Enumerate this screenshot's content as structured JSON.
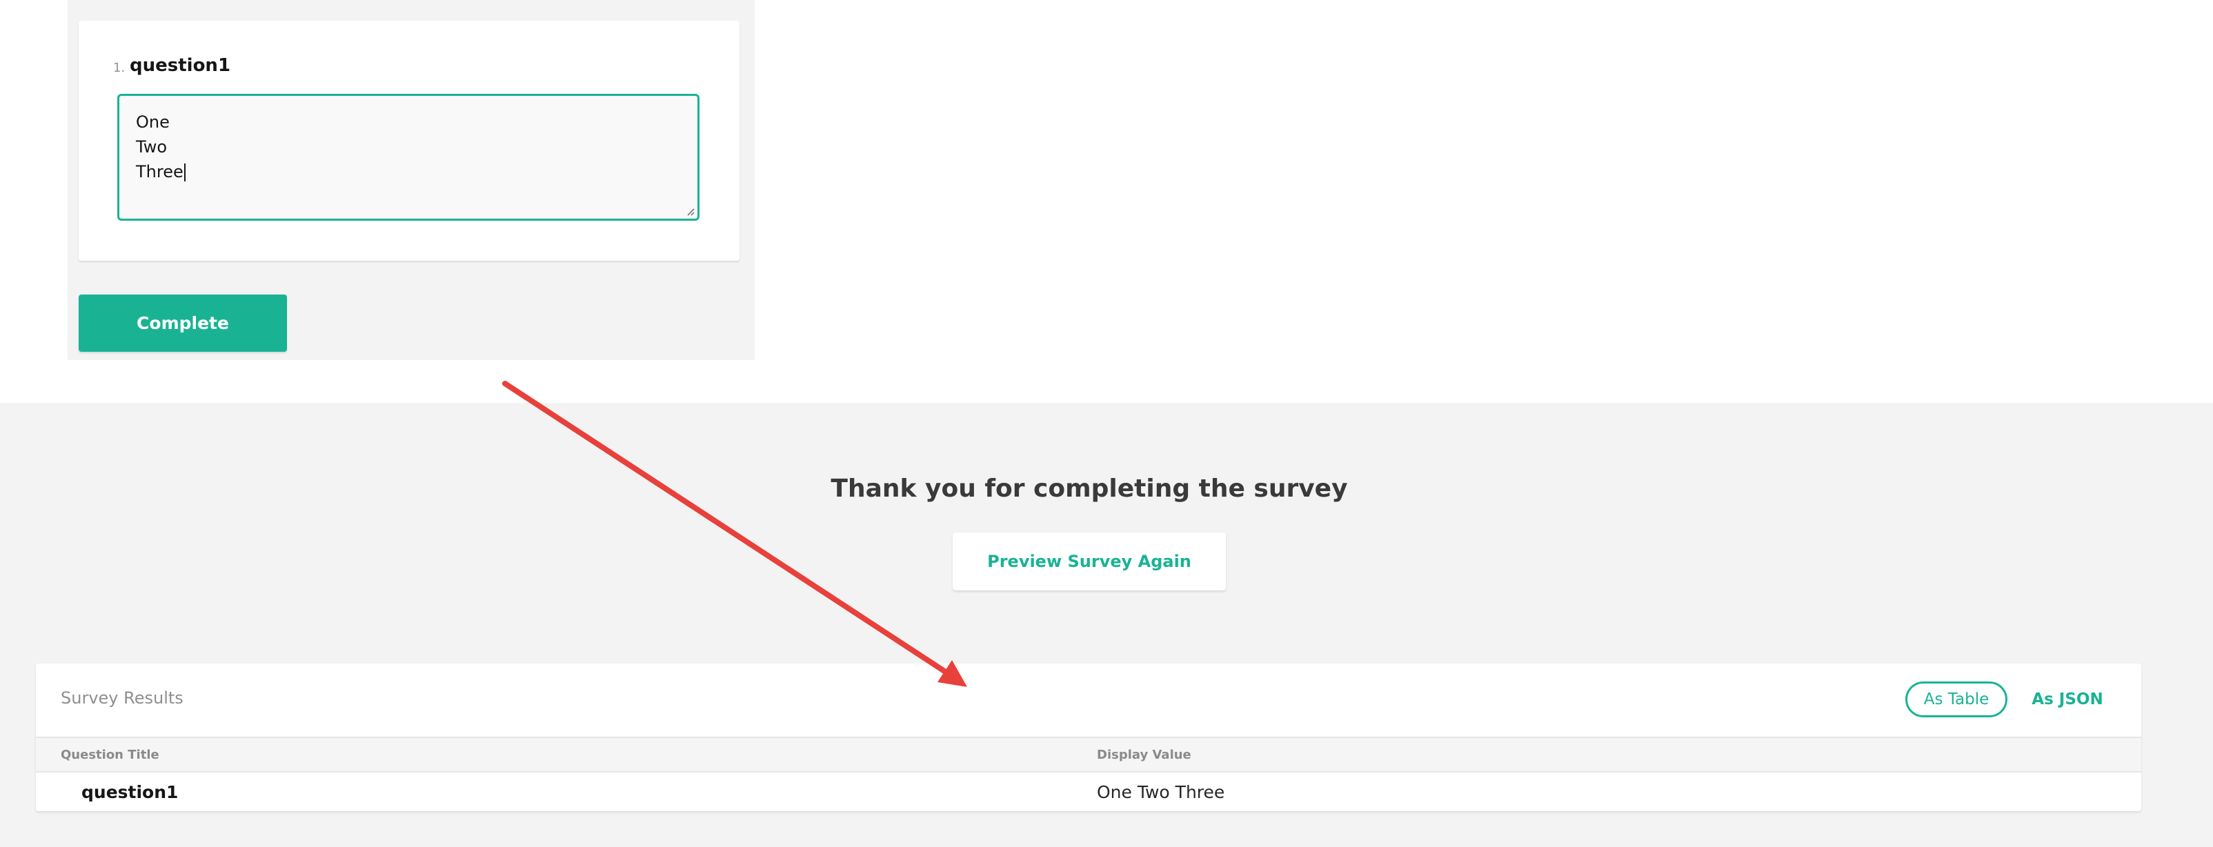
{
  "survey": {
    "question": {
      "number": "1.",
      "title": "question1",
      "answer_lines": [
        "One",
        "Two",
        "Three"
      ]
    },
    "complete_label": "Complete"
  },
  "completed": {
    "heading": "Thank you for completing the survey",
    "preview_again_label": "Preview Survey Again"
  },
  "results": {
    "title": "Survey Results",
    "as_table_label": "As Table",
    "as_json_label": "As JSON",
    "columns": [
      "Question Title",
      "Display Value"
    ],
    "rows": [
      {
        "question": "question1",
        "value": "One Two Three"
      }
    ]
  },
  "colors": {
    "accent": "#19b394",
    "panel_background": "#f3f3f3",
    "arrow": "#e8403b"
  }
}
